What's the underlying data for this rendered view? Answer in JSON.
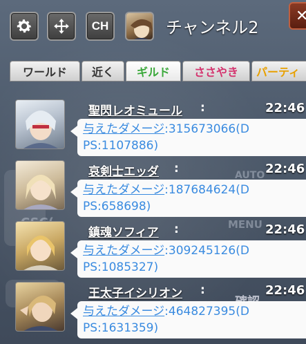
{
  "header": {
    "channel_title": "チャンネル2",
    "ch_button_label": "CH",
    "icons": [
      "gear-icon",
      "move-icon",
      "ch-icon",
      "portrait-icon",
      "close-icon"
    ]
  },
  "tabs": [
    {
      "label": "ワールド",
      "color": "#333333"
    },
    {
      "label": "近く",
      "color": "#333333"
    },
    {
      "label": "ギルド",
      "color": "#3aa83a"
    },
    {
      "label": "ささやき",
      "color": "#d4336e"
    },
    {
      "label": "パーティ",
      "color": "#e8a000"
    }
  ],
  "background_text": {
    "a": "CSC(",
    "b": "MENU",
    "c": "AUTO",
    "d": "確認"
  },
  "messages": [
    {
      "name": "聖閃レオミュール",
      "time": "22:46",
      "line1_prefix": "与えたダメージ",
      "line1_value": ":315673066(D",
      "line2": "PS:1107886)"
    },
    {
      "name": "哀剣士エッダ",
      "time": "22:46",
      "line1_prefix": "与えたダメージ",
      "line1_value": ":187684624(D",
      "line2": "PS:658698)"
    },
    {
      "name": "鎮魂ソフィア",
      "time": "22:46",
      "line1_prefix": "与えたダメージ",
      "line1_value": ":309245126(D",
      "line2": "PS:1085327)"
    },
    {
      "name": "王太子イシリオン",
      "time": "22:46",
      "line1_prefix": "与えたダメージ",
      "line1_value": ":464827395(D",
      "line2": "PS:1631359)"
    }
  ]
}
